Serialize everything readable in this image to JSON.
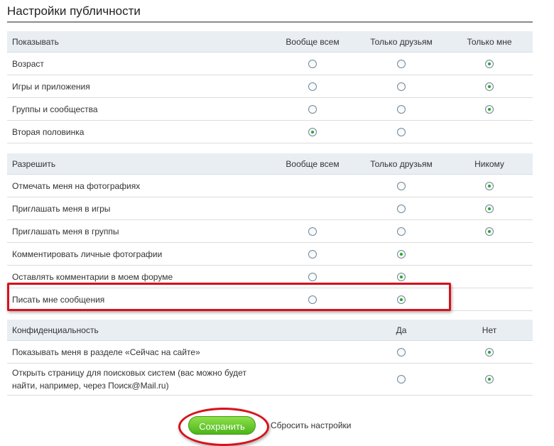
{
  "page": {
    "title": "Настройки публичности"
  },
  "show_section": {
    "header": {
      "label": "Показывать",
      "col1": "Вообще всем",
      "col2": "Только друзьям",
      "col3": "Только мне"
    },
    "rows": [
      {
        "label": "Возраст",
        "selected": "col3"
      },
      {
        "label": "Игры и приложения",
        "selected": "col3"
      },
      {
        "label": "Группы и сообщества",
        "selected": "col3"
      },
      {
        "label": "Вторая половинка",
        "selected": "col1"
      }
    ]
  },
  "allow_section": {
    "header": {
      "label": "Разрешить",
      "col1": "Вообще всем",
      "col2": "Только друзьям",
      "col3": "Никому"
    },
    "rows": [
      {
        "label": "Отмечать меня на фотографиях",
        "selected": "col3"
      },
      {
        "label": "Приглашать меня в игры",
        "selected": "col3"
      },
      {
        "label": "Приглашать меня в группы",
        "selected": "col3"
      },
      {
        "label": "Комментировать личные фотографии",
        "selected": "col2"
      },
      {
        "label": "Оставлять комментарии в моем форуме",
        "selected": "col2"
      },
      {
        "label": "Писать мне сообщения",
        "selected": "col2"
      }
    ]
  },
  "privacy_section": {
    "header": {
      "label": "Конфиденциальность",
      "col1": "Да",
      "col2": "Нет"
    },
    "rows": [
      {
        "label": "Показывать меня в разделе «Сейчас на сайте»",
        "selected": "no"
      },
      {
        "label": "Открыть страницу для поисковых систем (вас можно будет найти, например, через Поиск@Mail.ru)",
        "selected": "no"
      }
    ]
  },
  "actions": {
    "save_label": "Сохранить",
    "reset_label": "Сбросить настройки"
  },
  "colors": {
    "accent_green": "#4cb51b",
    "highlight_red": "#d7121a",
    "header_bg": "#e9eef3"
  }
}
